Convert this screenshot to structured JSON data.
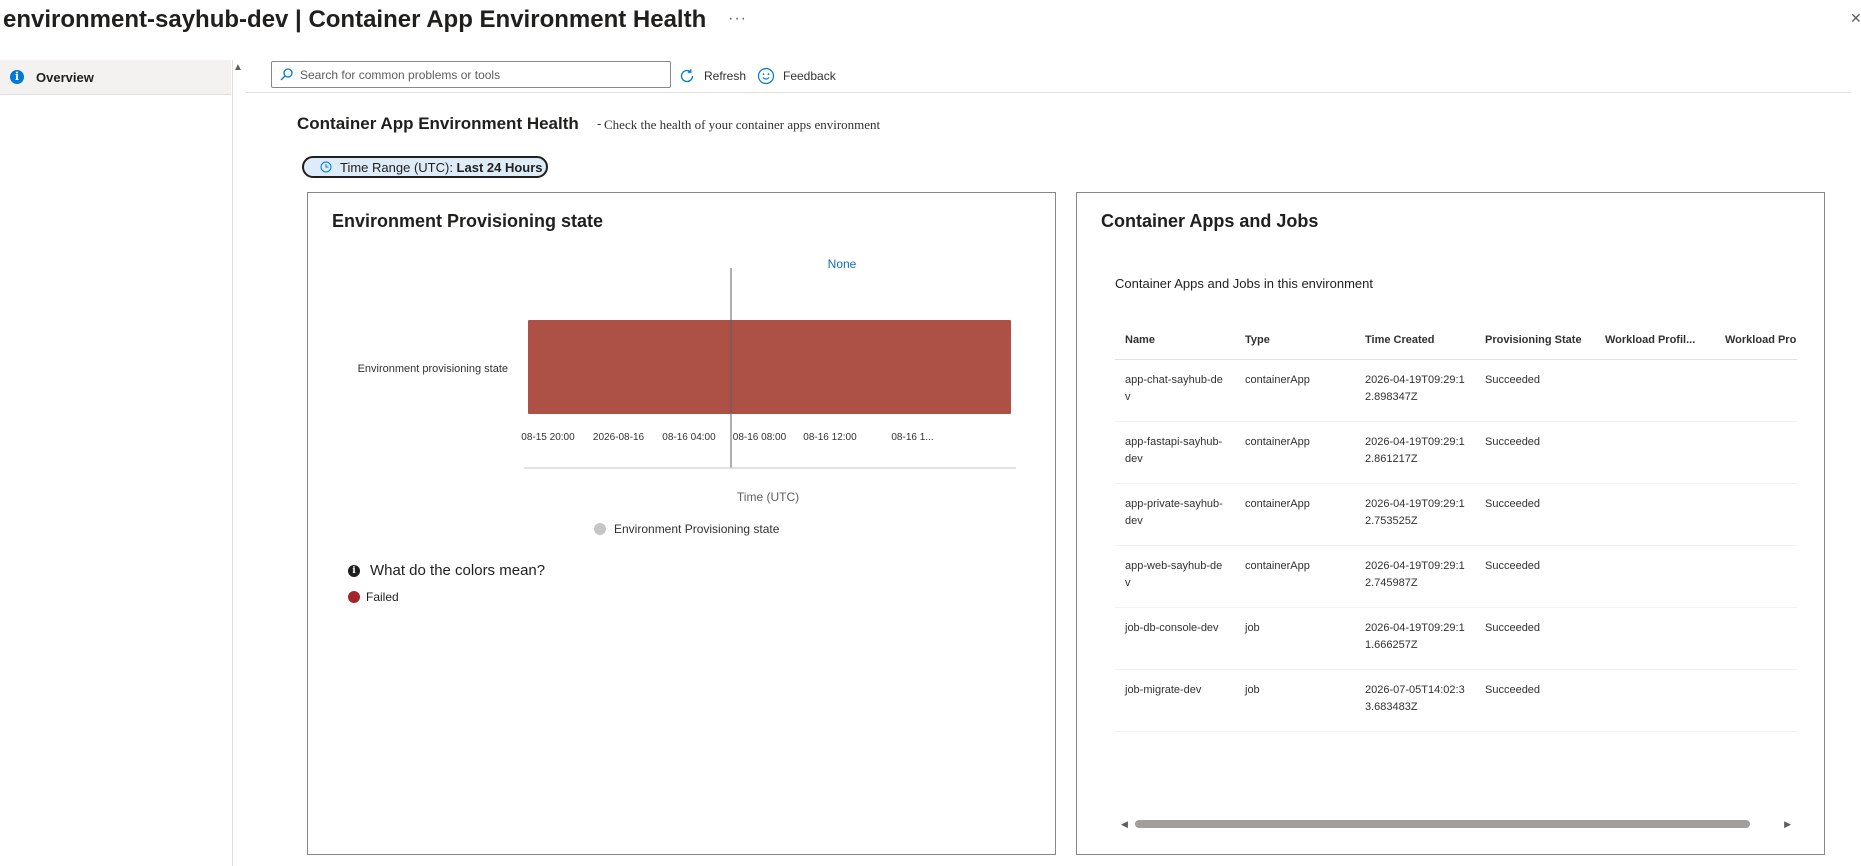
{
  "header": {
    "title": "environment-sayhub-dev | Container App Environment Health",
    "more_label": "···"
  },
  "sidebar": {
    "items": [
      {
        "label": "Overview",
        "icon": "info-icon"
      }
    ]
  },
  "toolbar": {
    "search_placeholder": "Search for common problems or tools",
    "refresh_label": "Refresh",
    "feedback_label": "Feedback"
  },
  "main": {
    "heading": "Container App Environment Health",
    "subheading": "Check the health of your container apps environment",
    "time_range": {
      "prefix": "Time Range (UTC): ",
      "value": "Last 24 Hours"
    }
  },
  "provisioning_panel": {
    "title": "Environment Provisioning state",
    "colors_question": "What do the colors mean?",
    "colors_legend": [
      {
        "label": "Failed",
        "color": "#a4262c"
      }
    ]
  },
  "chart_data": {
    "type": "bar",
    "orientation": "horizontal",
    "categories": [
      "Environment provisioning state"
    ],
    "series": [
      {
        "name": "Environment Provisioning state",
        "status": "Failed",
        "color": "#ad5147"
      }
    ],
    "x_ticks": [
      "08-15 20:00",
      "2026-08-16",
      "08-16 04:00",
      "08-16 08:00",
      "08-16 12:00",
      "08-16 1..."
    ],
    "xlabel": "Time (UTC)",
    "marker_label": "None",
    "legend": "bottom"
  },
  "apps_panel": {
    "title": "Container Apps and Jobs",
    "caption": "Container Apps and Jobs in this environment",
    "columns": [
      "Name",
      "Type",
      "Time Created",
      "Provisioning State",
      "Workload Profil...",
      "Workload Pro"
    ],
    "rows": [
      {
        "name": "app-chat-sayhub-dev",
        "type": "containerApp",
        "created": "2026-04-19T09:29:12.898347Z",
        "state": "Succeeded"
      },
      {
        "name": "app-fastapi-sayhub-dev",
        "type": "containerApp",
        "created": "2026-04-19T09:29:12.861217Z",
        "state": "Succeeded"
      },
      {
        "name": "app-private-sayhub-dev",
        "type": "containerApp",
        "created": "2026-04-19T09:29:12.753525Z",
        "state": "Succeeded"
      },
      {
        "name": "app-web-sayhub-dev",
        "type": "containerApp",
        "created": "2026-04-19T09:29:12.745987Z",
        "state": "Succeeded"
      },
      {
        "name": "job-db-console-dev",
        "type": "job",
        "created": "2026-04-19T09:29:11.666257Z",
        "state": "Succeeded"
      },
      {
        "name": "job-migrate-dev",
        "type": "job",
        "created": "2026-07-05T14:02:33.683483Z",
        "state": "Succeeded"
      }
    ]
  }
}
